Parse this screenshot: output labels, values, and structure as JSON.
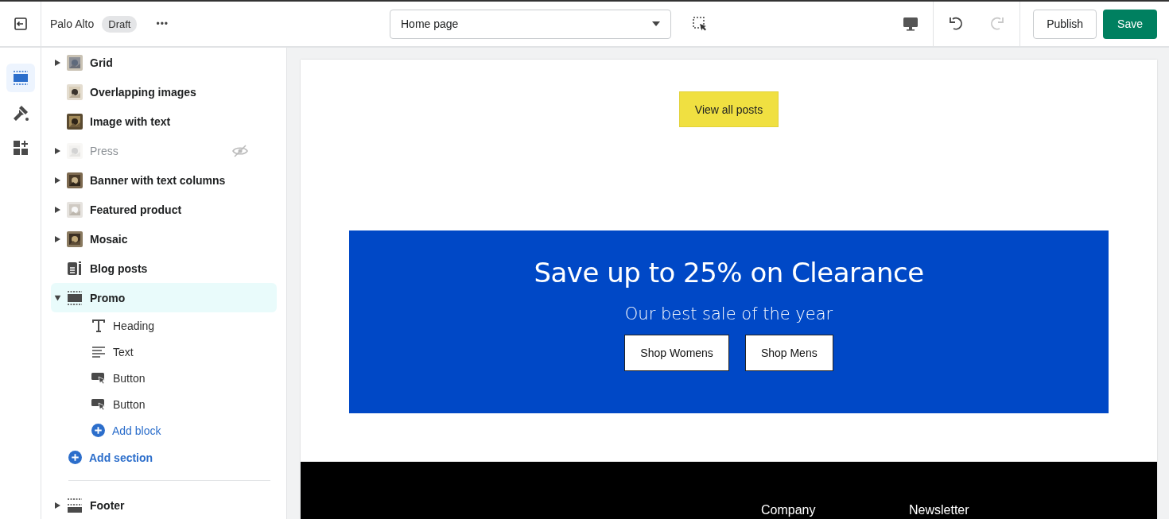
{
  "topbar": {
    "store": "Palo Alto",
    "status": "Draft",
    "more": "•••",
    "page_select": "Home page",
    "publish": "Publish",
    "save": "Save"
  },
  "rail": [
    {
      "kind": "sections",
      "selected": true
    },
    {
      "kind": "theme",
      "selected": false
    },
    {
      "kind": "apps",
      "selected": false
    }
  ],
  "sections": [
    {
      "label": "Grid",
      "kind": "picture",
      "expanded": false,
      "hidden": false,
      "selected": false
    },
    {
      "label": "Overlapping images",
      "kind": "picture",
      "hidden": false,
      "selected": false
    },
    {
      "label": "Image with text",
      "kind": "picture",
      "hidden": false,
      "selected": false
    },
    {
      "label": "Press",
      "kind": "picture",
      "expanded": false,
      "hidden": true,
      "selected": false
    },
    {
      "label": "Banner with text columns",
      "kind": "picture",
      "expanded": false,
      "hidden": false,
      "selected": false
    },
    {
      "label": "Featured product",
      "kind": "picture",
      "expanded": false,
      "hidden": false,
      "selected": false
    },
    {
      "label": "Mosaic",
      "kind": "picture",
      "expanded": false,
      "hidden": false,
      "selected": false
    },
    {
      "label": "Blog posts",
      "kind": "blog",
      "hidden": false,
      "selected": false
    },
    {
      "label": "Promo",
      "kind": "layout",
      "expanded": true,
      "hidden": false,
      "selected": true,
      "children": [
        {
          "kind": "heading",
          "label": "Heading"
        },
        {
          "kind": "text",
          "label": "Text"
        },
        {
          "kind": "button",
          "label": "Button"
        },
        {
          "kind": "button",
          "label": "Button"
        }
      ],
      "add_block": "Add block"
    }
  ],
  "add_section": "Add section",
  "footer_sections": [
    {
      "label": "Footer",
      "kind": "footer",
      "expanded": false,
      "hidden": false,
      "selected": false
    }
  ],
  "canvas": {
    "view_all": "View all posts",
    "promo": {
      "heading": "Save up to 25% on Clearance",
      "subheading": "Our best sale of the year",
      "buttons": [
        "Shop Womens",
        "Shop Mens"
      ]
    },
    "footer_columns": [
      "Company",
      "Newsletter"
    ]
  }
}
